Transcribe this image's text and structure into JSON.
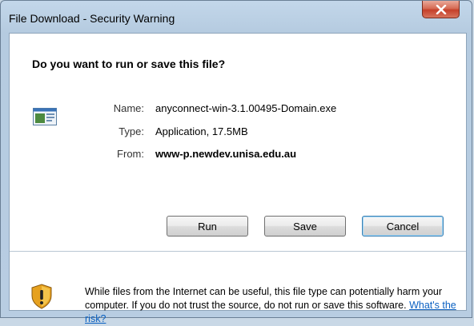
{
  "window": {
    "title": "File Download - Security Warning"
  },
  "dialog": {
    "question": "Do you want to run or save this file?",
    "fields": {
      "name_label": "Name:",
      "name_value": "anyconnect-win-3.1.00495-Domain.exe",
      "type_label": "Type:",
      "type_value": "Application, 17.5MB",
      "from_label": "From:",
      "from_value": "www-p.newdev.unisa.edu.au"
    },
    "buttons": {
      "run": "Run",
      "save": "Save",
      "cancel": "Cancel"
    },
    "warning": {
      "text": "While files from the Internet can be useful, this file type can potentially harm your computer. If you do not trust the source, do not run or save this software.",
      "link": "What's the risk?"
    }
  },
  "icons": {
    "close": "close-icon",
    "file": "application-file-icon",
    "shield": "security-shield-warning-icon"
  },
  "colors": {
    "accent": "#3c7fb1",
    "link": "#0b61c2",
    "close_button": "#c5402a"
  }
}
